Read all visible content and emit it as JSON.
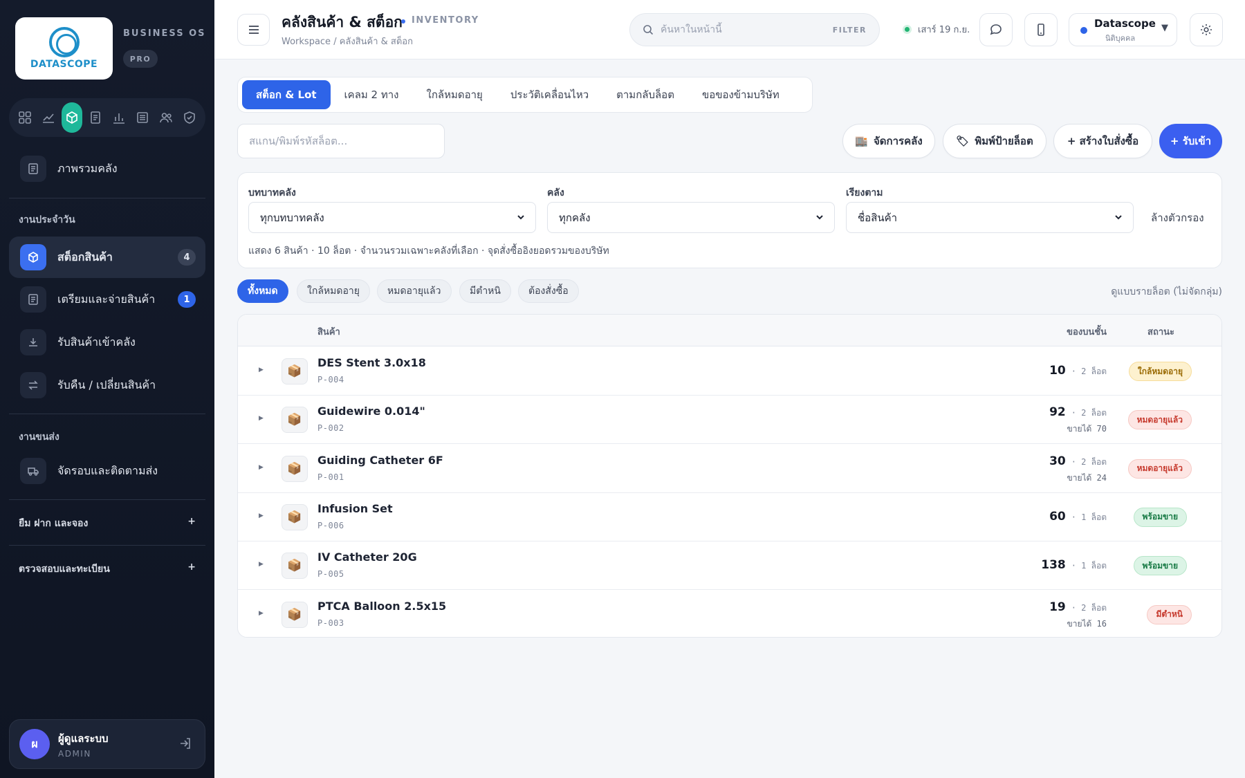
{
  "brand": {
    "logo_text": "DATASCOPE",
    "tagline": "BUSINESS OS",
    "plan": "PRO"
  },
  "sidebar": {
    "overview": "ภาพรวมคลัง",
    "section_daily": "งานประจำวัน",
    "items": [
      {
        "label": "สต็อกสินค้า",
        "badge": "4"
      },
      {
        "label": "เตรียมและจ่ายสินค้า",
        "badge": "1"
      },
      {
        "label": "รับสินค้าเข้าคลัง"
      },
      {
        "label": "รับคืน / เปลี่ยนสินค้า"
      }
    ],
    "section_transport": "งานขนส่ง",
    "transport_item": "จัดรอบและติดตามส่ง",
    "collapsed": [
      {
        "label": "ยืม ฝาก และจอง",
        "toggle": "+"
      },
      {
        "label": "ตรวจสอบและทะเบียน",
        "toggle": "+"
      }
    ],
    "user": {
      "initial": "ผ",
      "name": "ผู้ดูแลระบบ",
      "role": "ADMIN"
    }
  },
  "header": {
    "title": "คลังสินค้า & สต็อก",
    "tag": "INVENTORY",
    "breadcrumb": "Workspace / คลังสินค้า & สต็อก",
    "search_placeholder": "ค้นหาในหน้านี้",
    "search_filter": "FILTER",
    "date": "เสาร์ 19 ก.ย.",
    "org_name": "Datascope",
    "org_type": "นิติบุคคล",
    "org_caret": "▼"
  },
  "tabs": [
    "สต็อก & Lot",
    "เคลม 2 ทาง",
    "ใกล้หมดอายุ",
    "ประวัติเคลื่อนไหว",
    "ตามกลับล็อต",
    "ขอของข้ามบริษัท"
  ],
  "lot_input_placeholder": "สแกน/พิมพ์รหัสล็อต...",
  "actions": {
    "manage": "จัดการคลัง",
    "print": "พิมพ์ป้ายล็อต",
    "create_po": "+ สร้างใบสั่งซื้อ",
    "receive": "+ รับเข้า"
  },
  "filters": {
    "role_label": "บทบาทคลัง",
    "role_value": "ทุกบทบาทคลัง",
    "warehouse_label": "คลัง",
    "warehouse_value": "ทุกคลัง",
    "sort_label": "เรียงตาม",
    "sort_value": "ชื่อสินค้า",
    "clear": "ล้างตัวกรอง",
    "summary": "แสดง 6 สินค้า · 10 ล็อต · จำนวนรวมเฉพาะคลังที่เลือก · จุดสั่งซื้ออิงยอดรวมของบริษัท"
  },
  "chips": [
    "ทั้งหมด",
    "ใกล้หมดอายุ",
    "หมดอายุแล้ว",
    "มีตำหนิ",
    "ต้องสั่งซื้อ"
  ],
  "view_toggle": "ดูแบบรายล็อต (ไม่จัดกลุ่ม)",
  "table": {
    "columns": {
      "product": "สินค้า",
      "stock": "ของบนชั้น",
      "status": "สถานะ"
    },
    "rows": [
      {
        "name": "DES Stent 3.0x18",
        "code": "P-004",
        "qty": "10",
        "lots": "· 2 ล็อต",
        "sellable": "",
        "status": "ใกล้หมดอายุ",
        "status_type": "warn"
      },
      {
        "name": "Guidewire 0.014\"",
        "code": "P-002",
        "qty": "92",
        "lots": "· 2 ล็อต",
        "sellable": "ขายได้ 70",
        "status": "หมดอายุแล้ว",
        "status_type": "red"
      },
      {
        "name": "Guiding Catheter 6F",
        "code": "P-001",
        "qty": "30",
        "lots": "· 2 ล็อต",
        "sellable": "ขายได้ 24",
        "status": "หมดอายุแล้ว",
        "status_type": "red"
      },
      {
        "name": "Infusion Set",
        "code": "P-006",
        "qty": "60",
        "lots": "· 1 ล็อต",
        "sellable": "",
        "status": "พร้อมขาย",
        "status_type": "green"
      },
      {
        "name": "IV Catheter 20G",
        "code": "P-005",
        "qty": "138",
        "lots": "· 1 ล็อต",
        "sellable": "",
        "status": "พร้อมขาย",
        "status_type": "green"
      },
      {
        "name": "PTCA Balloon 2.5x15",
        "code": "P-003",
        "qty": "19",
        "lots": "· 2 ล็อต",
        "sellable": "ขายได้ 16",
        "status": "มีตำหนิ",
        "status_type": "red"
      }
    ]
  }
}
